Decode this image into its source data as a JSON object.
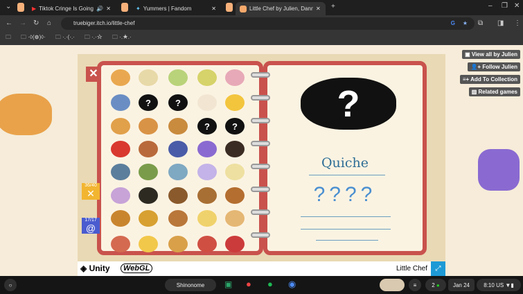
{
  "browser": {
    "tabs": [
      {
        "title": "Tiktok Cringe Is Going Too",
        "icon": "youtube-icon",
        "audio": true
      },
      {
        "title": "Yummers | Fandom",
        "icon": "fandom-icon"
      },
      {
        "title": "Little Chef by Julien, Danny-vD",
        "icon": "itch-icon",
        "active": true
      }
    ],
    "url": "truebiger.itch.io/little-chef",
    "bookmarks": [
      "",
      "·◊(❁)◊·",
      "·.·(·.·",
      "·.·☆",
      "·.★.·"
    ]
  },
  "side_buttons": [
    "View all by Julien",
    "Follow Julien",
    "Add To Collection",
    "Related games"
  ],
  "game": {
    "recipe_name": "Quiche",
    "unknown_text": "????",
    "question_mark": "?",
    "close": "✕",
    "badges": [
      {
        "count": "36/40",
        "icon": "fork-knife-icon",
        "color": "#f2b531"
      },
      {
        "count": "17/17",
        "icon": "spiral-icon",
        "color": "#4a5ccf"
      }
    ],
    "foods": [
      [
        "#e9a84f",
        "#e8d9a8",
        "#b9d37a",
        "#d6d36a",
        "#e7a9b7"
      ],
      [
        "#6a8ec4",
        "?",
        "?",
        "#f2e6d2",
        "#f3c53d"
      ],
      [
        "#e1a04a",
        "#d99346",
        "#c98b3e",
        "?",
        "?"
      ],
      [
        "#d9382e",
        "#b96a3c",
        "#4a5ca8",
        "#8a6ad1",
        "#3b2c23"
      ],
      [
        "#5b7e9c",
        "#7a9c4a",
        "#7fa8c2",
        "#c3b3e8",
        "#eee0a0"
      ],
      [
        "#c7a3d8",
        "#2d2a22",
        "#8a5a2c",
        "#a86f34",
        "#b46e30"
      ],
      [
        "#c9852e",
        "#d7a031",
        "#b9773a",
        "#f0d26c",
        "#e5b774"
      ],
      [
        "#d46a50",
        "#f2c84a",
        "#d9a049",
        "#d04f43",
        "#cc3b3b"
      ]
    ]
  },
  "unity_bar": {
    "brand": "Unity",
    "webgl": "WebGL",
    "title": "Little Chef"
  },
  "shelf": {
    "user": "Shinonome",
    "notifications": "2",
    "date": "Jan 24",
    "time": "8:10",
    "locale": "US"
  }
}
